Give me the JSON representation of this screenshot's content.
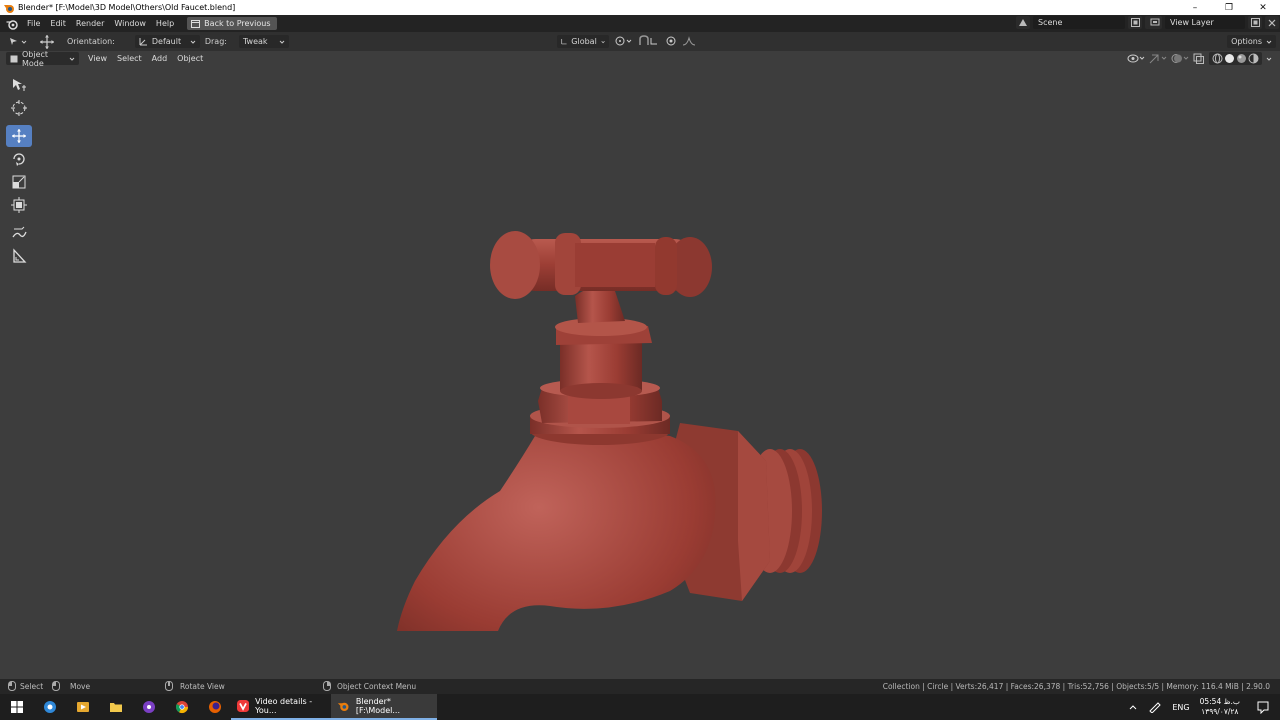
{
  "window": {
    "title": "Blender* [F:\\Model\\3D Model\\Others\\Old Faucet.blend]",
    "controls": [
      "–",
      "❐",
      "✕"
    ]
  },
  "topbar": {
    "menus": [
      "File",
      "Edit",
      "Render",
      "Window",
      "Help"
    ],
    "back_label": "Back to Previous",
    "scene": "Scene",
    "view_layer": "View Layer"
  },
  "toolheader": {
    "orientation_label": "Orientation:",
    "orientation_value": "Default",
    "drag_label": "Drag:",
    "drag_value": "Tweak",
    "transform_orientation": "Global",
    "options_label": "Options"
  },
  "viewport_header": {
    "mode": "Object Mode",
    "menus": [
      "View",
      "Select",
      "Add",
      "Object"
    ]
  },
  "toolbar": {
    "tools": [
      "select-box",
      "cursor",
      "move",
      "rotate",
      "scale",
      "transform",
      "annotate",
      "measure"
    ],
    "active": "move"
  },
  "statusbar": {
    "select": "Select",
    "move": "Move",
    "rotate_view": "Rotate View",
    "context_menu": "Object Context Menu",
    "stats": "Collection | Circle | Verts:26,417 | Faces:26,378 | Tris:52,756 | Objects:5/5 | Memory: 116.4 MiB | 2.90.0"
  },
  "taskbar": {
    "apps": [
      {
        "label": "Video details - You...",
        "active": false
      },
      {
        "label": "Blender* [F:\\Model...",
        "active": true
      }
    ],
    "lang": "ENG",
    "time": "05:54 ب.ظ",
    "date": "۱۳۹۹/۰۷/۲۸"
  },
  "colors": {
    "faucet": "#9b3d33",
    "accent": "#5680c2"
  }
}
